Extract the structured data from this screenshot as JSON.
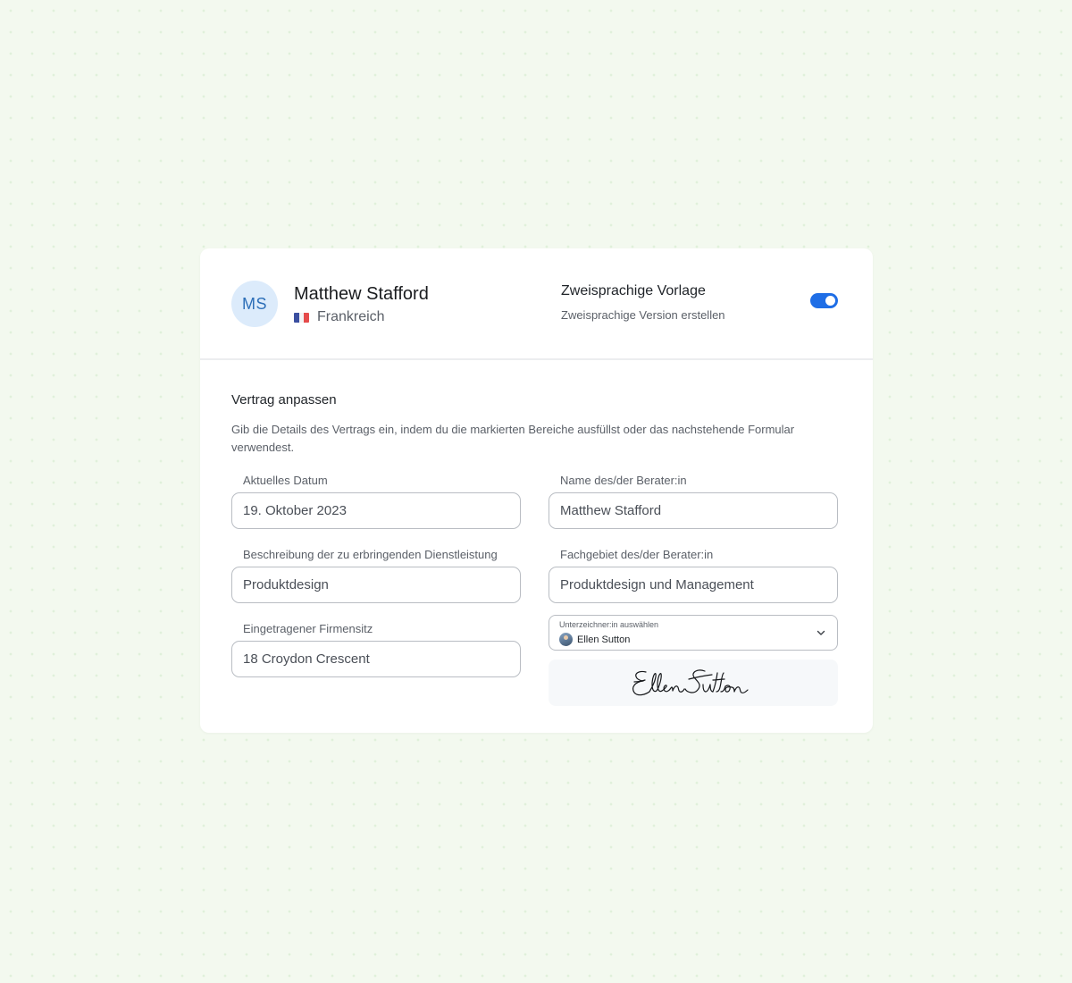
{
  "person": {
    "initials": "MS",
    "name": "Matthew Stafford",
    "country": "Frankreich"
  },
  "template": {
    "title": "Zweisprachige Vorlage",
    "subtitle": "Zweisprachige Version erstellen",
    "toggle_on": true,
    "toggle_color": "#1f6ee6"
  },
  "contract": {
    "title": "Vertrag anpassen",
    "description": "Gib die Details des Vertrags ein, indem du die markierten Bereiche ausfüllst oder das nachstehende Formular verwendest."
  },
  "fields": {
    "current_date": {
      "label": "Aktuelles Datum",
      "value": "19. Oktober 2023"
    },
    "consultant_name": {
      "label": "Name des/der Berater:in",
      "value": "Matthew Stafford"
    },
    "service_description": {
      "label": "Beschreibung der zu erbringenden Dienstleistung",
      "value": "Produktdesign"
    },
    "consultant_field": {
      "label": "Fachgebiet des/der Berater:in",
      "value": "Produktdesign und Management"
    },
    "registered_office": {
      "label": "Eingetragener Firmensitz",
      "value": "18 Croydon Crescent"
    }
  },
  "signer": {
    "caption": "Unterzeichner:in auswählen",
    "selected": "Ellen Sutton",
    "signature": "Ellen Sutton"
  },
  "colors": {
    "background": "#f3f9ef",
    "accent": "#1f6ee6",
    "avatar_bg": "#dcebfb"
  }
}
